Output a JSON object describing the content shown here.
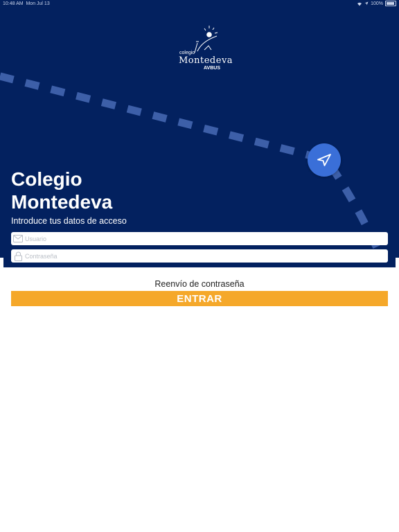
{
  "status_bar": {
    "time": "10:48 AM",
    "date": "Mon Jul 13",
    "battery": "100%"
  },
  "logo": {
    "small": "colegio",
    "main": "Montedeva",
    "sub": "AVBUS"
  },
  "header": {
    "title_line1": "Colegio",
    "title_line2": "Montedeva",
    "subtitle": "Introduce tus datos de acceso"
  },
  "form": {
    "user_placeholder": "Usuario",
    "user_value": "",
    "password_placeholder": "Contraseña",
    "password_value": "",
    "resend_label": "Reenvío de contraseña",
    "enter_label": "ENTRAR"
  },
  "icons": {
    "user_field": "mail-icon",
    "password_field": "lock-icon",
    "fab": "send-arrow-icon"
  },
  "colors": {
    "header_bg": "#03215f",
    "dashes": "#3d5fa8",
    "fab": "#3a6fd8",
    "primary_button": "#f5a82a"
  }
}
